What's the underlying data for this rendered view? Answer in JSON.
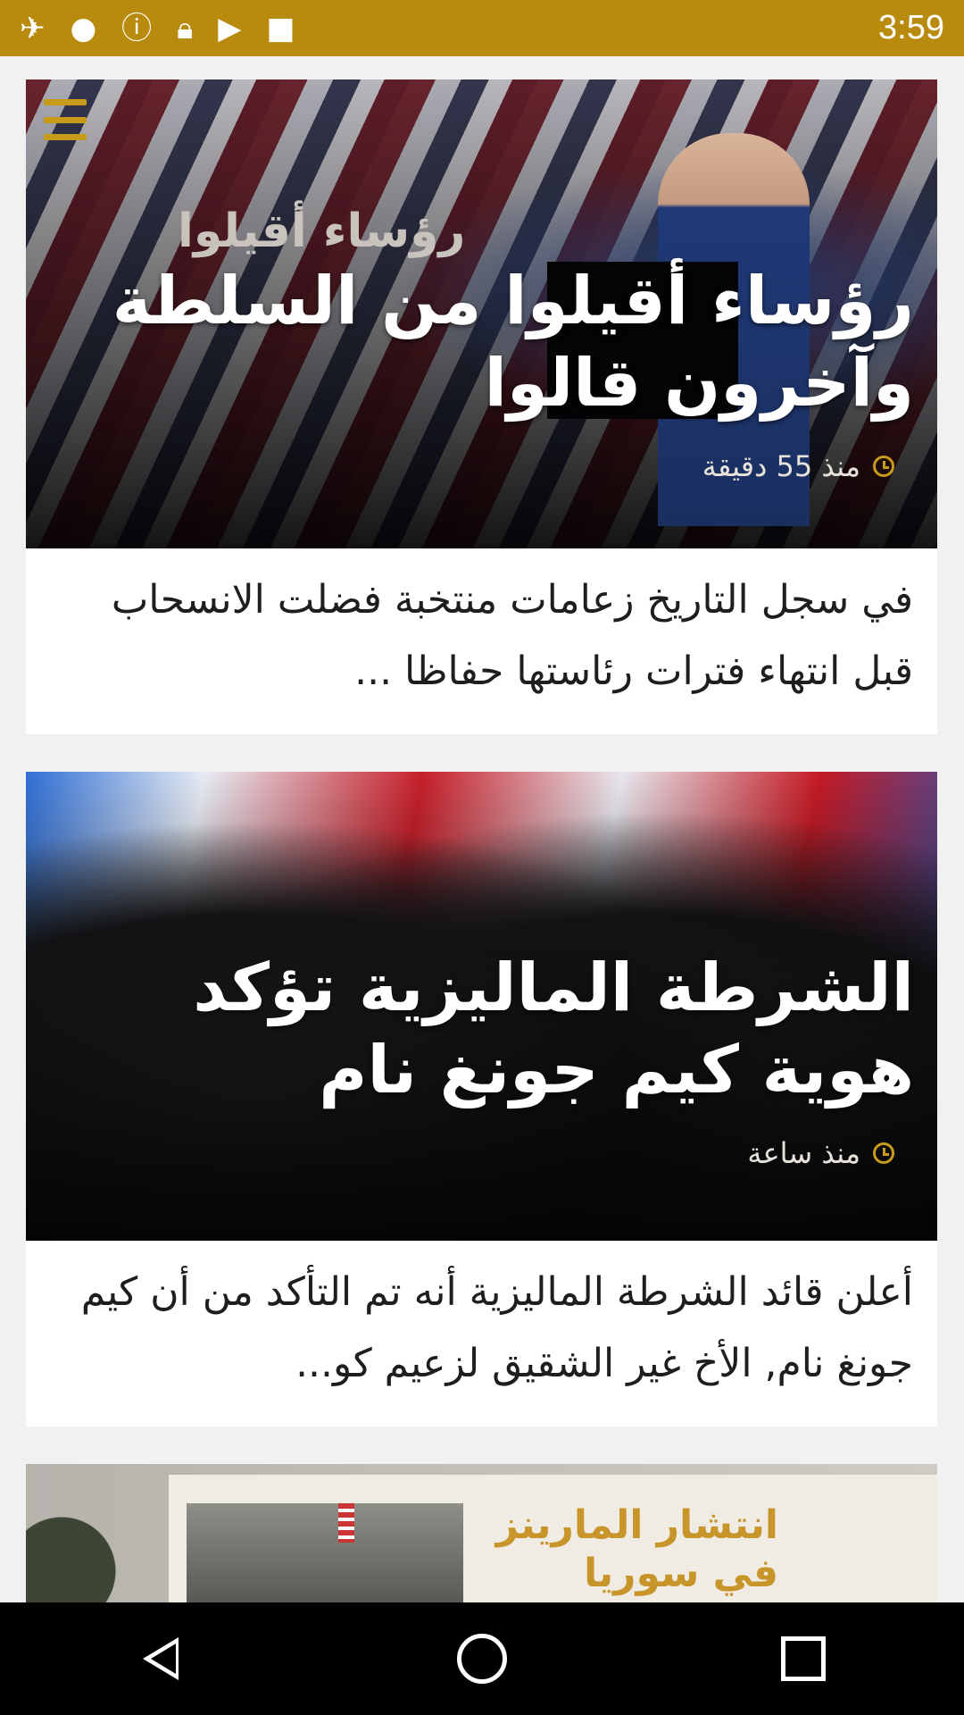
{
  "status_bar": {
    "time": "3:59",
    "icons": [
      "satellite-icon",
      "notification-icon",
      "info-icon",
      "lock-icon",
      "youtube-icon",
      "android-icon"
    ]
  },
  "articles": [
    {
      "headline": "رؤساء أقيلوا من السلطة وآخرون قالوا",
      "timestamp": "منذ 55 دقيقة",
      "summary": "في سجل التاريخ زعامات منتخبة فضلت الانسحاب قبل انتهاء فترات رئاستها حفاظا ...",
      "image_caption": "رؤساء أقيلوا"
    },
    {
      "headline": "الشرطة الماليزية تؤكد هوية كيم جونغ نام",
      "timestamp": "منذ ساعة",
      "summary": "أعلن قائد الشرطة الماليزية أنه تم التأكد من أن كيم جونغ نام, الأخ غير الشقيق لزعيم كو..."
    },
    {
      "promo_text_line1": "انتشار المارينز",
      "promo_text_line2": "في سوريا"
    }
  ],
  "colors": {
    "status_bar": "#b88a0e",
    "accent": "#c79a18"
  }
}
